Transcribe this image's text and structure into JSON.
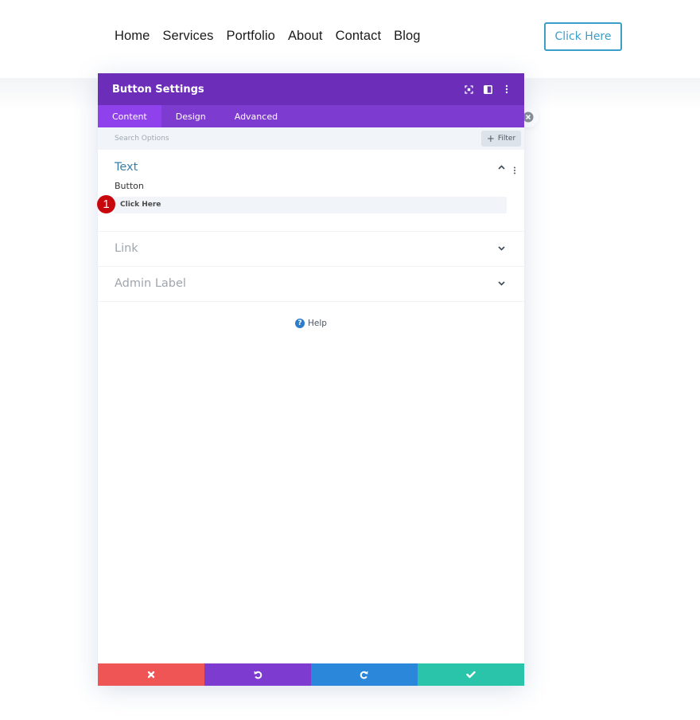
{
  "site_header": {
    "nav": [
      "Home",
      "Services",
      "Portfolio",
      "About",
      "Contact",
      "Blog"
    ],
    "cta_label": "Click Here",
    "cta_color": "#3a9ec8"
  },
  "modal": {
    "title": "Button Settings",
    "header_icons": [
      "expand-icon",
      "split-view-icon",
      "more-options-icon"
    ],
    "tabs": [
      {
        "label": "Content",
        "active": true
      },
      {
        "label": "Design",
        "active": false
      },
      {
        "label": "Advanced",
        "active": false
      }
    ],
    "search_placeholder": "Search Options",
    "filter_label": "Filter",
    "sections": [
      {
        "title": "Text",
        "open": true,
        "field_label": "Button",
        "field_value": "Click Here",
        "badge": "1"
      },
      {
        "title": "Link",
        "open": false
      },
      {
        "title": "Admin Label",
        "open": false
      }
    ],
    "help_label": "Help",
    "footer": {
      "cancel_icon": "close-icon",
      "undo_icon": "undo-icon",
      "redo_icon": "redo-icon",
      "save_icon": "check-icon"
    },
    "colors": {
      "header": "#6c2eb9",
      "tabs": "#7e3bd0",
      "active_tab": "#8f42ec",
      "cancel": "#ef5555",
      "undo": "#7e3bd0",
      "redo": "#2b87da",
      "save": "#29c4a9"
    }
  }
}
